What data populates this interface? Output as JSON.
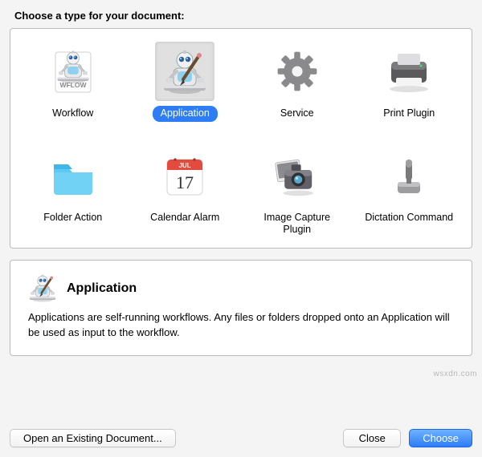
{
  "prompt": "Choose a type for your document:",
  "types": [
    {
      "id": "workflow",
      "label": "Workflow",
      "icon": "workflow-icon"
    },
    {
      "id": "application",
      "label": "Application",
      "icon": "application-icon",
      "selected": true
    },
    {
      "id": "service",
      "label": "Service",
      "icon": "service-icon"
    },
    {
      "id": "print-plugin",
      "label": "Print Plugin",
      "icon": "printer-icon"
    },
    {
      "id": "folder-action",
      "label": "Folder Action",
      "icon": "folder-icon"
    },
    {
      "id": "calendar-alarm",
      "label": "Calendar Alarm",
      "icon": "calendar-icon"
    },
    {
      "id": "image-capture",
      "label": "Image Capture Plugin",
      "icon": "camera-icon"
    },
    {
      "id": "dictation",
      "label": "Dictation Command",
      "icon": "microphone-icon"
    }
  ],
  "calendar": {
    "month": "JUL",
    "day": "17"
  },
  "description": {
    "title": "Application",
    "text": "Applications are self-running workflows. Any files or folders dropped onto an Application will be used as input to the workflow."
  },
  "buttons": {
    "open_existing": "Open an Existing Document...",
    "close": "Close",
    "choose": "Choose"
  },
  "watermark": "wsxdn.com"
}
